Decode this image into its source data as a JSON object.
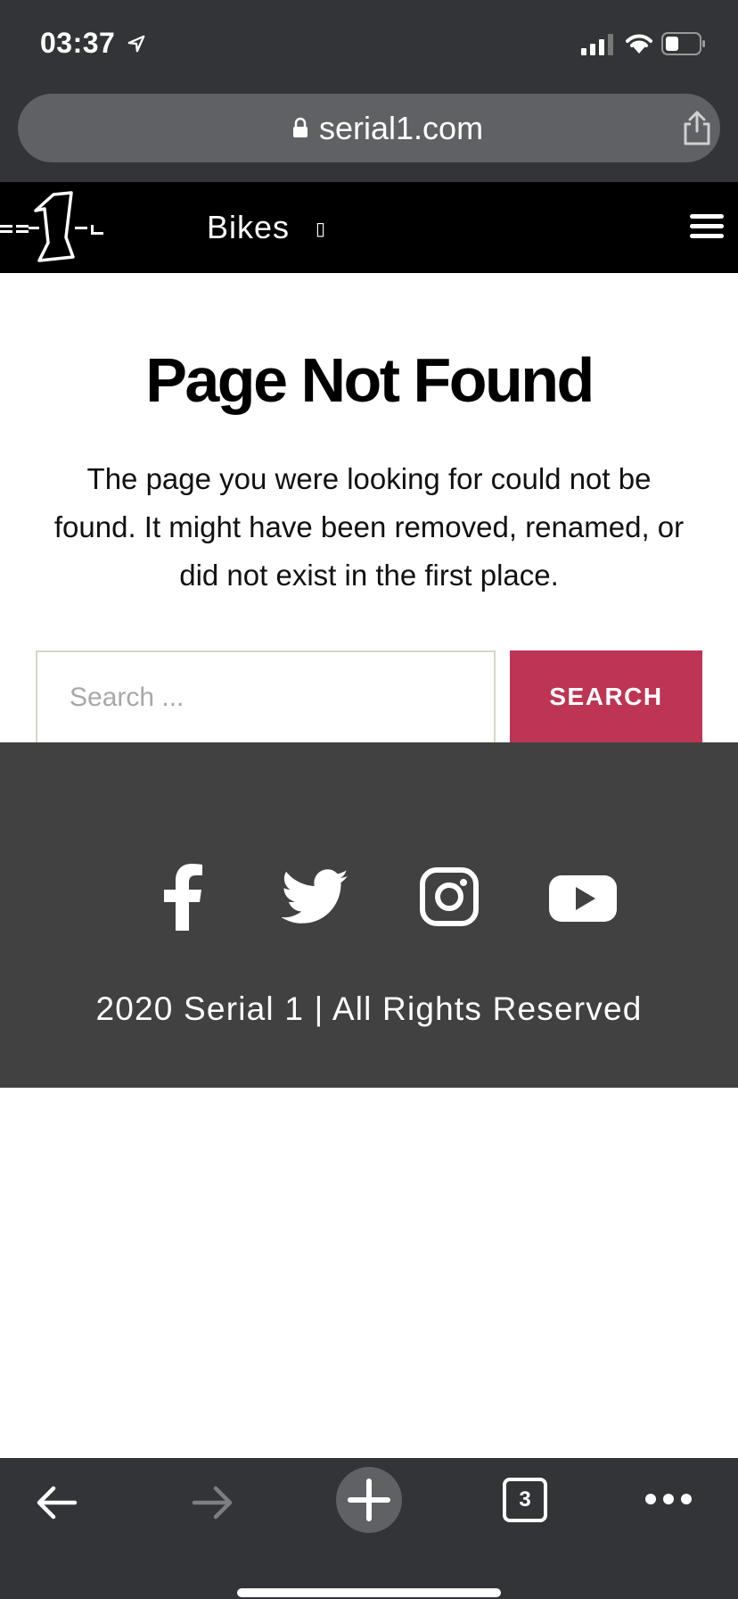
{
  "status_bar": {
    "time": "03:37",
    "icons": [
      "location-arrow-icon",
      "signal-icon",
      "wifi-icon",
      "battery-icon"
    ]
  },
  "browser": {
    "url": "serial1.com",
    "icons": [
      "lock-icon",
      "share-icon"
    ]
  },
  "header": {
    "logo_alt": "SERIAL 1",
    "nav_bikes": "Bikes",
    "nav_caret": "▯",
    "icons": [
      "menu-icon"
    ]
  },
  "main": {
    "title": "Page Not Found",
    "message": "The page you were looking for could not be found. It might have been removed, renamed, or did not exist in the first place.",
    "search_placeholder": "Search ...",
    "search_button": "SEARCH"
  },
  "footer": {
    "social": [
      "facebook-icon",
      "twitter-icon",
      "instagram-icon",
      "youtube-icon"
    ],
    "copyright": "2020 Serial 1 | All Rights Reserved"
  },
  "toolbar": {
    "tab_count": "3",
    "icons": [
      "back-arrow-icon",
      "forward-arrow-icon",
      "new-tab-icon",
      "tabs-icon",
      "more-icon"
    ]
  },
  "colors": {
    "chrome": "#333437",
    "url_pill": "#5f6165",
    "header_bg": "#000000",
    "accent": "#be3454",
    "footer_bg": "#414141",
    "search_border": "#d8d4c8"
  }
}
